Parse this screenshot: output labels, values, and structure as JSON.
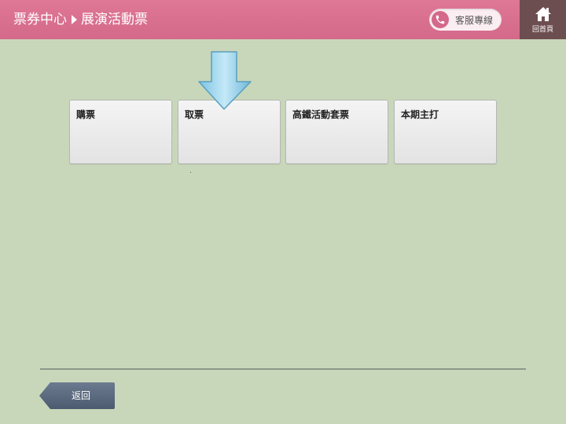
{
  "header": {
    "breadcrumb_root": "票券中心",
    "breadcrumb_current": "展演活動票",
    "service_label": "客服專線",
    "home_label": "回首頁"
  },
  "tiles": [
    {
      "label": "購票"
    },
    {
      "label": "取票"
    },
    {
      "label": "高鐵活動套票"
    },
    {
      "label": "本期主打"
    }
  ],
  "footer": {
    "back_label": "返回"
  },
  "colors": {
    "header_bg": "#d4698a",
    "home_bg": "#6d4e50",
    "page_bg": "#c8d7ba",
    "back_button": "#5a6a80",
    "pointer_arrow": "#9fd4ec"
  },
  "icons": [
    "phone-icon",
    "home-icon",
    "down-arrow-pointer"
  ]
}
